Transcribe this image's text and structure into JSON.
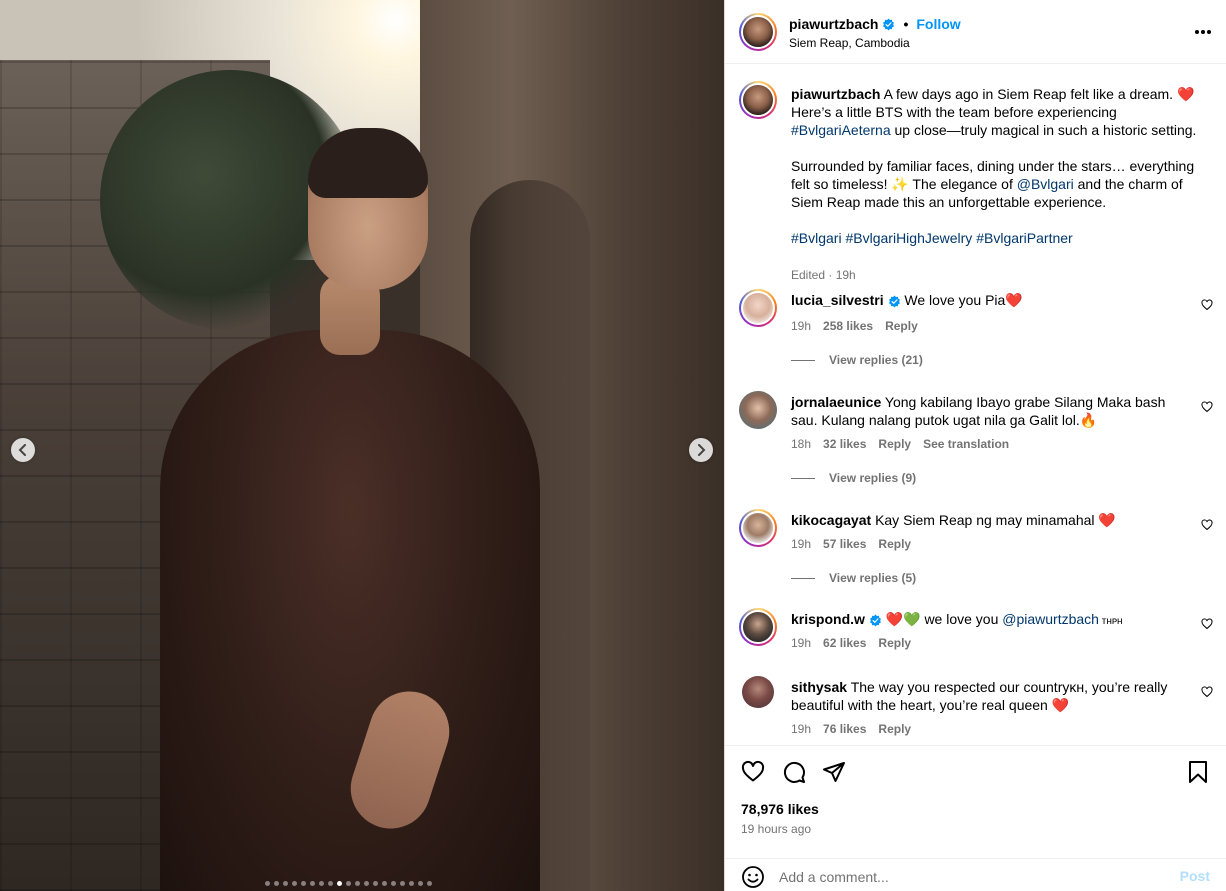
{
  "post": {
    "username": "piawurtzbach",
    "separator": "•",
    "follow_label": "Follow",
    "location": "Siem Reap, Cambodia",
    "more_icon": "more-horizontal-icon"
  },
  "photo": {
    "prev_icon": "chevron-left-icon",
    "next_icon": "chevron-right-icon",
    "slide_count": 19,
    "active_slide_index": 8
  },
  "caption": {
    "username": "piawurtzbach",
    "line1_a": " A few days ago in Siem Reap felt like a dream.",
    "line1_heart": "❤️",
    "line1_b": " Here’s a little BTS with the team before experiencing ",
    "tag1": "#BvlgariAeterna",
    "line1_c": " up close—truly magical in such a historic setting.",
    "para2_a": "Surrounded by familiar faces, dining under the stars… everything felt so timeless! ✨ The elegance of ",
    "mention": "@Bvlgari",
    "para2_b": " and the charm of Siem Reap made this an unforgettable experience.",
    "hashtags": [
      "#Bvlgari",
      "#BvlgariHighJewelry",
      "#BvlgariPartner"
    ],
    "meta": "Edited · 19h"
  },
  "comments": [
    {
      "username": "lucia_silvestri",
      "verified": true,
      "text": "We love you Pia❤️",
      "time": "19h",
      "likes": "258 likes",
      "reply": "Reply",
      "view_replies": "View replies (21)"
    },
    {
      "username": "jornalaeunice",
      "verified": false,
      "text": "Yong kabilang Ibayo grabe Silang Maka bash sau. Kulang nalang putok ugat nila ga Galit lol.🔥",
      "time": "18h",
      "likes": "32 likes",
      "reply": "Reply",
      "translate": "See translation",
      "view_replies": "View replies (9)"
    },
    {
      "username": "kikocagayat",
      "verified": false,
      "text": "Kay Siem Reap ng may minamahal ❤️",
      "time": "19h",
      "likes": "57 likes",
      "reply": "Reply",
      "view_replies": "View replies (5)"
    },
    {
      "username": "krispond.w",
      "verified": true,
      "text_a": "❤️💚 we love you ",
      "mention": "@piawurtzbach",
      "text_b": " ᴛʜᴘʜ",
      "time": "19h",
      "likes": "62 likes",
      "reply": "Reply"
    },
    {
      "username": "sithysak",
      "verified": false,
      "text": "The way you respected our countryᴋʜ, you’re really beautiful with the heart, you’re real queen ❤️",
      "time": "19h",
      "likes": "76 likes",
      "reply": "Reply"
    }
  ],
  "actions": {
    "like_icon": "heart-icon",
    "comment_icon": "comment-icon",
    "share_icon": "send-icon",
    "save_icon": "bookmark-icon"
  },
  "likes_count": "78,976 likes",
  "time_ago": "19 hours ago",
  "comment_box": {
    "emoji_icon": "emoji-icon",
    "placeholder": "Add a comment...",
    "post_label": "Post"
  },
  "colors": {
    "link_blue": "#0095f6",
    "tag_blue": "#00376b",
    "muted": "#737373",
    "post_disabled": "#b2dffc"
  }
}
